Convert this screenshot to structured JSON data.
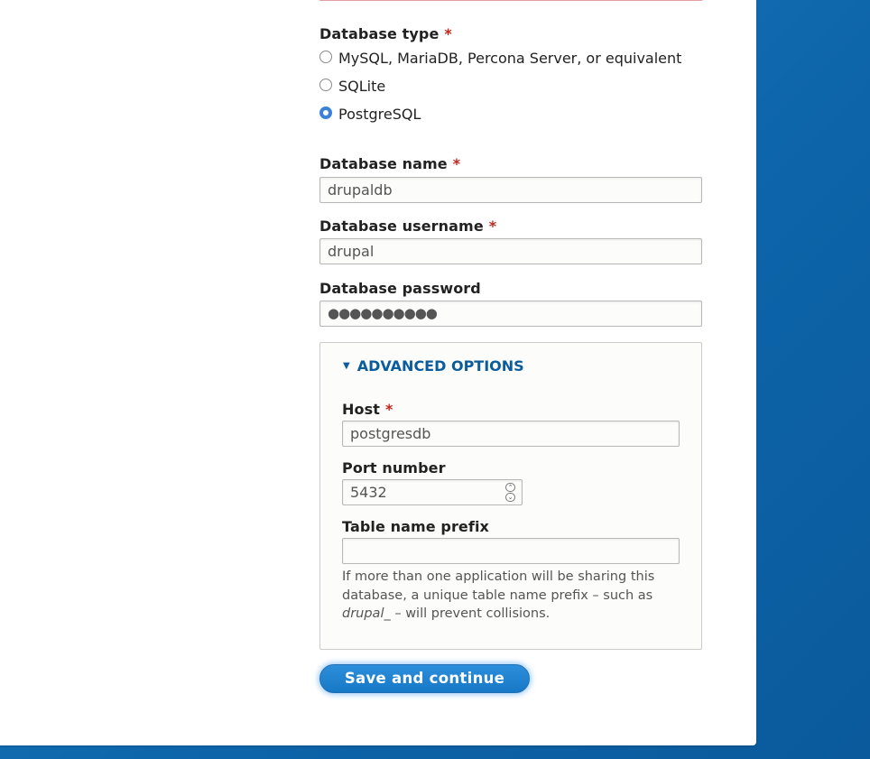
{
  "form": {
    "db_type": {
      "label": "Database type",
      "required_mark": "*",
      "options": [
        {
          "label": "MySQL, MariaDB, Percona Server, or equivalent",
          "checked": false
        },
        {
          "label": "SQLite",
          "checked": false
        },
        {
          "label": "PostgreSQL",
          "checked": true
        }
      ]
    },
    "db_name": {
      "label": "Database name",
      "required_mark": "*",
      "value": "drupaldb"
    },
    "db_username": {
      "label": "Database username",
      "required_mark": "*",
      "value": "drupal"
    },
    "db_password": {
      "label": "Database password",
      "value": "●●●●●●●●●●"
    },
    "advanced": {
      "summary": "ADVANCED OPTIONS",
      "toggle_icon": "triangle-down-icon",
      "host": {
        "label": "Host",
        "required_mark": "*",
        "value": "postgresdb"
      },
      "port": {
        "label": "Port number",
        "value": "5432"
      },
      "prefix": {
        "label": "Table name prefix",
        "value": "",
        "description_part1": "If more than one application will be sharing this database, a unique table name prefix – such as ",
        "description_em": "drupal_",
        "description_part2": " – will prevent collisions."
      }
    },
    "submit_label": "Save and continue"
  },
  "colors": {
    "required": "#c4241a",
    "link": "#0a5c9c",
    "button": "#1778c6",
    "background": "#0d64a8"
  }
}
